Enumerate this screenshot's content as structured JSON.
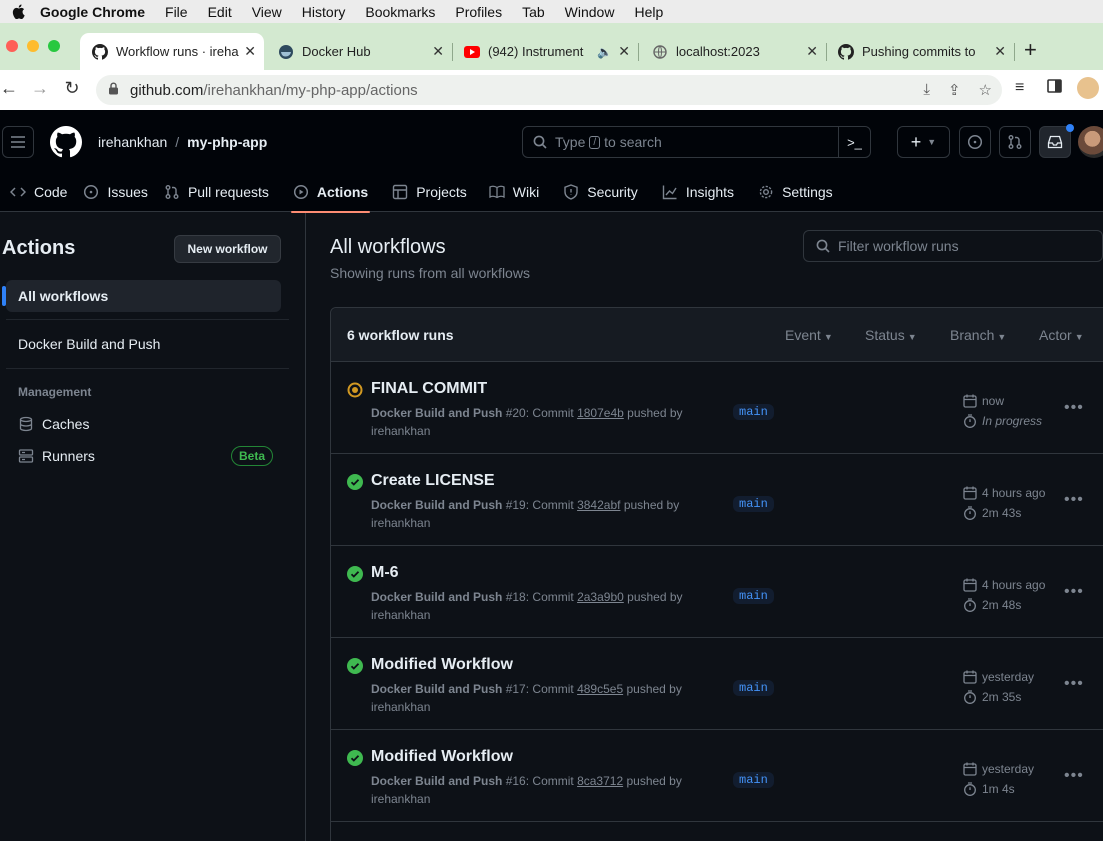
{
  "mac_menu": {
    "app": "Google Chrome",
    "items": [
      "File",
      "Edit",
      "View",
      "History",
      "Bookmarks",
      "Profiles",
      "Tab",
      "Window",
      "Help"
    ]
  },
  "tabs": [
    {
      "title": "Workflow runs · ireha",
      "icon": "github-icon",
      "active": true
    },
    {
      "title": "Docker Hub",
      "icon": "docker-icon",
      "active": false
    },
    {
      "title": "(942) Instrument",
      "icon": "youtube-icon",
      "active": false
    },
    {
      "title": "localhost:2023",
      "icon": "globe-icon",
      "active": false
    },
    {
      "title": "Pushing commits to",
      "icon": "github-icon",
      "active": false
    }
  ],
  "address": {
    "host": "github.com",
    "path": "/irehankhan/my-php-app/actions"
  },
  "repo": {
    "owner": "irehankhan",
    "separator": "/",
    "name": "my-php-app"
  },
  "search": {
    "prefix": "Type",
    "key": "/",
    "suffix": "to search"
  },
  "repo_nav": [
    {
      "label": "Code",
      "icon": "code-icon"
    },
    {
      "label": "Issues",
      "icon": "issue-icon"
    },
    {
      "label": "Pull requests",
      "icon": "pull-request-icon"
    },
    {
      "label": "Actions",
      "icon": "play-icon",
      "active": true
    },
    {
      "label": "Projects",
      "icon": "table-icon"
    },
    {
      "label": "Wiki",
      "icon": "book-icon"
    },
    {
      "label": "Security",
      "icon": "shield-icon"
    },
    {
      "label": "Insights",
      "icon": "graph-icon"
    },
    {
      "label": "Settings",
      "icon": "gear-icon"
    }
  ],
  "sidebar": {
    "title": "Actions",
    "new_workflow": "New workflow",
    "all_workflows": "All workflows",
    "workflow": "Docker Build and Push",
    "management_heading": "Management",
    "caches": "Caches",
    "runners": "Runners",
    "beta": "Beta"
  },
  "main": {
    "title": "All workflows",
    "subtitle": "Showing runs from all workflows",
    "filter_placeholder": "Filter workflow runs",
    "count": "6 workflow runs",
    "filters": [
      "Event",
      "Status",
      "Branch",
      "Actor"
    ]
  },
  "runs": [
    {
      "title": "FINAL COMMIT",
      "workflow": "Docker Build and Push",
      "number": "#20",
      "commit_label": ": Commit",
      "sha": "1807e4b",
      "pushed": "pushed by",
      "actor": "irehankhan",
      "branch": "main",
      "when": "now",
      "duration": "In progress",
      "status": "in_progress"
    },
    {
      "title": "Create LICENSE",
      "workflow": "Docker Build and Push",
      "number": "#19",
      "commit_label": ": Commit",
      "sha": "3842abf",
      "pushed": "pushed by",
      "actor": "irehankhan",
      "branch": "main",
      "when": "4 hours ago",
      "duration": "2m 43s",
      "status": "success"
    },
    {
      "title": "M-6",
      "workflow": "Docker Build and Push",
      "number": "#18",
      "commit_label": ": Commit",
      "sha": "2a3a9b0",
      "pushed": "pushed by",
      "actor": "irehankhan",
      "branch": "main",
      "when": "4 hours ago",
      "duration": "2m 48s",
      "status": "success"
    },
    {
      "title": "Modified Workflow",
      "workflow": "Docker Build and Push",
      "number": "#17",
      "commit_label": ": Commit",
      "sha": "489c5e5",
      "pushed": "pushed by",
      "actor": "irehankhan",
      "branch": "main",
      "when": "yesterday",
      "duration": "2m 35s",
      "status": "success"
    },
    {
      "title": "Modified Workflow",
      "workflow": "Docker Build and Push",
      "number": "#16",
      "commit_label": ": Commit",
      "sha": "8ca3712",
      "pushed": "pushed by",
      "actor": "irehankhan",
      "branch": "main",
      "when": "yesterday",
      "duration": "1m 4s",
      "status": "success"
    }
  ],
  "colors": {
    "success": "#3fb950",
    "in_progress": "#d29922",
    "accent": "#2f81f7",
    "underline": "#fd8c73"
  }
}
